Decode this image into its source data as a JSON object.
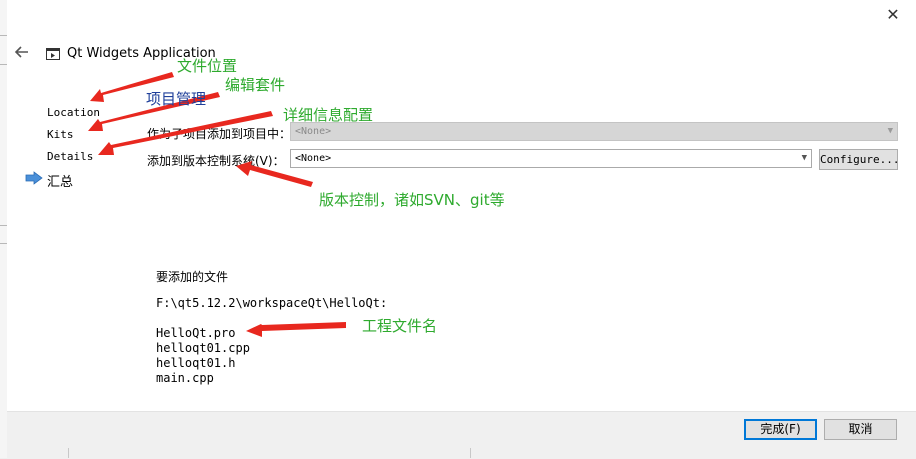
{
  "window": {
    "close_glyph": "✕"
  },
  "wizard": {
    "title": "Qt Widgets Application",
    "steps": [
      "Location",
      "Kits",
      "Details",
      "汇总"
    ],
    "current_step": "汇总"
  },
  "form": {
    "subproject_label": "作为子项目添加到项目中：",
    "subproject_value": "<None>",
    "vcs_label": "添加到版本控制系统(V)：",
    "vcs_value": "<None>",
    "configure_label": "Configure..."
  },
  "files": {
    "heading": "要添加的文件",
    "path": "F:\\qt5.12.2\\workspaceQt\\HelloQt:",
    "list": [
      "HelloQt.pro",
      "helloqt01.cpp",
      "helloqt01.h",
      "main.cpp"
    ]
  },
  "buttons": {
    "finish": "完成(F)",
    "cancel": "取消"
  },
  "annotations": {
    "file_location": "文件位置",
    "kits": "编辑套件",
    "project_management": "项目管理",
    "details": "详细信息配置",
    "vcs": "版本控制，诸如SVN、git等",
    "project_file": "工程文件名"
  },
  "colors": {
    "annotation": "#2eaa2e",
    "arrow": "#e8281f",
    "accent": "#0078d7",
    "step_arrow": "#4a90d9"
  },
  "icons": [
    "back-arrow-icon",
    "app-window-icon",
    "current-step-arrow-icon",
    "chevron-down-icon",
    "close-icon"
  ]
}
